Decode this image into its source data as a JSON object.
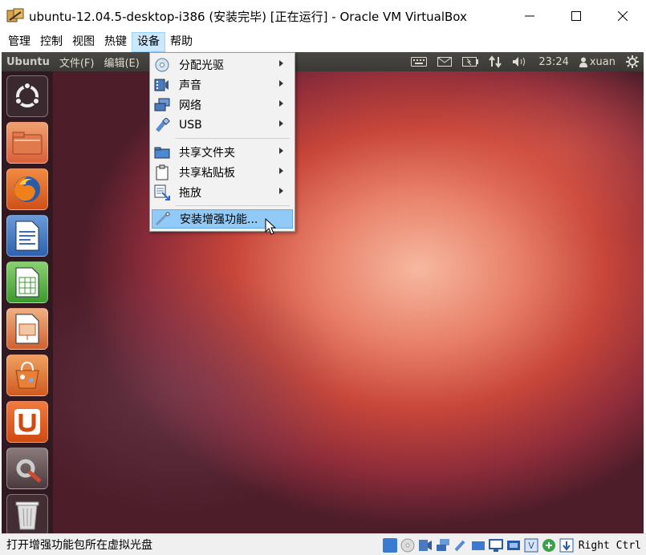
{
  "window": {
    "title": "ubuntu-12.04.5-desktop-i386 (安装完毕) [正在运行] - Oracle VM VirtualBox",
    "minimize_icon": "—",
    "maximize_icon": "☐",
    "close_icon": "✕"
  },
  "menubar": {
    "items": [
      {
        "label": "管理"
      },
      {
        "label": "控制"
      },
      {
        "label": "视图"
      },
      {
        "label": "热键"
      },
      {
        "label": "设备",
        "active": true
      },
      {
        "label": "帮助"
      }
    ]
  },
  "guest": {
    "panel": {
      "brand": "Ubuntu",
      "menus": [
        "文件(F)",
        "编辑(E)"
      ],
      "clock": "23:24",
      "user": "xuan"
    },
    "launcher": [
      {
        "name": "dash-home-icon"
      },
      {
        "name": "files-icon"
      },
      {
        "name": "firefox-icon"
      },
      {
        "name": "libreoffice-writer-icon"
      },
      {
        "name": "libreoffice-calc-icon"
      },
      {
        "name": "libreoffice-impress-icon"
      },
      {
        "name": "software-center-icon"
      },
      {
        "name": "ubuntu-one-icon"
      },
      {
        "name": "system-settings-icon"
      },
      {
        "name": "trash-icon"
      }
    ]
  },
  "devices_menu": {
    "items": [
      {
        "label": "分配光驱",
        "icon": "optical-drive-icon",
        "submenu": true
      },
      {
        "label": "声音",
        "icon": "audio-icon",
        "submenu": true
      },
      {
        "label": "网络",
        "icon": "network-icon",
        "submenu": true
      },
      {
        "label": "USB",
        "icon": "usb-icon",
        "submenu": true
      },
      {
        "label": "共享文件夹",
        "icon": "shared-folder-icon",
        "submenu": true
      },
      {
        "label": "共享粘贴板",
        "icon": "clipboard-icon",
        "submenu": true
      },
      {
        "label": "拖放",
        "icon": "drag-drop-icon",
        "submenu": true
      },
      {
        "label": "安装增强功能...",
        "icon": "guest-additions-icon",
        "submenu": false,
        "highlighted": true
      }
    ]
  },
  "statusbar": {
    "text": "打开增强功能包所在虚拟光盘",
    "host_key": "Right Ctrl"
  },
  "colors": {
    "menu_highlight": "#91c9f7",
    "menubar_active": "#cce8ff",
    "ubuntu_panel": "#3c3b37",
    "ubuntu_orange": "#dd4814"
  }
}
